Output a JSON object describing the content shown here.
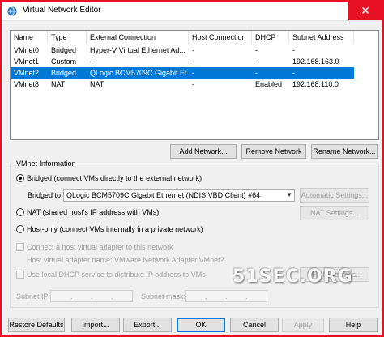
{
  "window": {
    "title": "Virtual Network Editor",
    "close_glyph": "✕"
  },
  "table": {
    "columns": [
      "Name",
      "Type",
      "External Connection",
      "Host Connection",
      "DHCP",
      "Subnet Address"
    ],
    "rows": [
      [
        "VMnet0",
        "Bridged",
        "Hyper-V Virtual Ethernet Ad...",
        "-",
        "-",
        "-"
      ],
      [
        "VMnet1",
        "Custom",
        "-",
        "-",
        "-",
        "192.168.163.0"
      ],
      [
        "VMnet2",
        "Bridged",
        "QLogic BCM5709C Gigabit Et...",
        "-",
        "-",
        "-"
      ],
      [
        "VMnet8",
        "NAT",
        "NAT",
        "-",
        "Enabled",
        "192.168.110.0"
      ]
    ],
    "selected_row": "VMnet2"
  },
  "list_buttons": {
    "add": "Add Network...",
    "remove": "Remove Network",
    "rename": "Rename Network..."
  },
  "vmnet_info": {
    "group_label": "VMnet Information",
    "bridged_label": "Bridged (connect VMs directly to the external network)",
    "bridged_to_label": "Bridged to:",
    "bridged_to_value": "QLogic BCM5709C Gigabit Ethernet (NDIS VBD Client) #64",
    "auto_settings": "Automatic Settings...",
    "nat_label": "NAT (shared host's IP address with VMs)",
    "nat_settings": "NAT Settings...",
    "hostonly_label": "Host-only (connect VMs internally in a private network)",
    "connect_adapter_label": "Connect a host virtual adapter to this network",
    "adapter_name_label": "Host virtual adapter name: VMware Network Adapter VMnet2",
    "dhcp_label": "Use local DHCP service to distribute IP address to VMs",
    "dhcp_settings": "DHCP Settings...",
    "subnet_ip_label": "Subnet IP:",
    "subnet_mask_label": "Subnet mask:",
    "ip_dot": "."
  },
  "watermark": "51SEC.ORG",
  "footer": {
    "restore": "Restore Defaults",
    "import": "Import...",
    "export": "Export...",
    "ok": "OK",
    "cancel": "Cancel",
    "apply": "Apply",
    "help": "Help"
  }
}
